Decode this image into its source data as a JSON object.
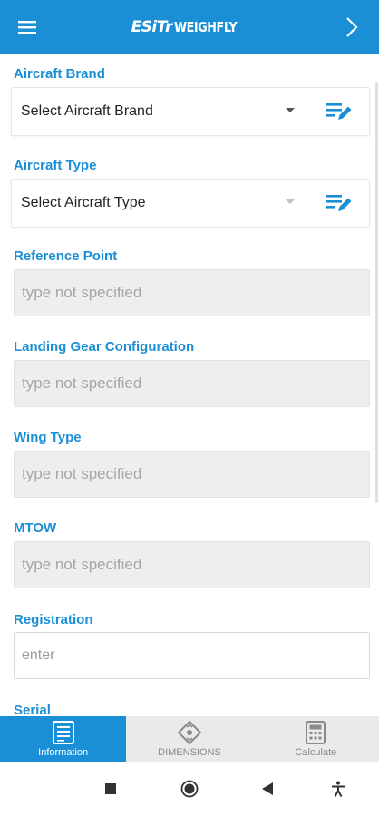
{
  "appbar": {
    "logo_brand": "ESiTr",
    "logo_product": "WEIGHFLY",
    "bg_color": "#1a8fd6"
  },
  "form": {
    "aircraft_brand": {
      "label": "Aircraft Brand",
      "value": "Select Aircraft Brand"
    },
    "aircraft_type": {
      "label": "Aircraft Type",
      "value": "Select Aircraft Type"
    },
    "reference_point": {
      "label": "Reference Point",
      "value": "type not specified"
    },
    "landing_gear": {
      "label": "Landing  Gear Configuration",
      "value": "type not specified"
    },
    "wing_type": {
      "label": "Wing Type",
      "value": "type not specified"
    },
    "mtow": {
      "label": "MTOW",
      "value": "type not specified"
    },
    "registration": {
      "label": "Registration",
      "placeholder": "enter"
    },
    "serial": {
      "label": "Serial"
    }
  },
  "tabs": [
    {
      "label": "Information",
      "icon": "form-icon",
      "active": true
    },
    {
      "label": "DIMENSIONS",
      "icon": "dimensions-icon",
      "active": false
    },
    {
      "label": "Calculate",
      "icon": "calculator-icon",
      "active": false
    }
  ],
  "system_nav": [
    "recent-apps-icon",
    "home-icon",
    "back-icon",
    "accessibility-icon"
  ]
}
